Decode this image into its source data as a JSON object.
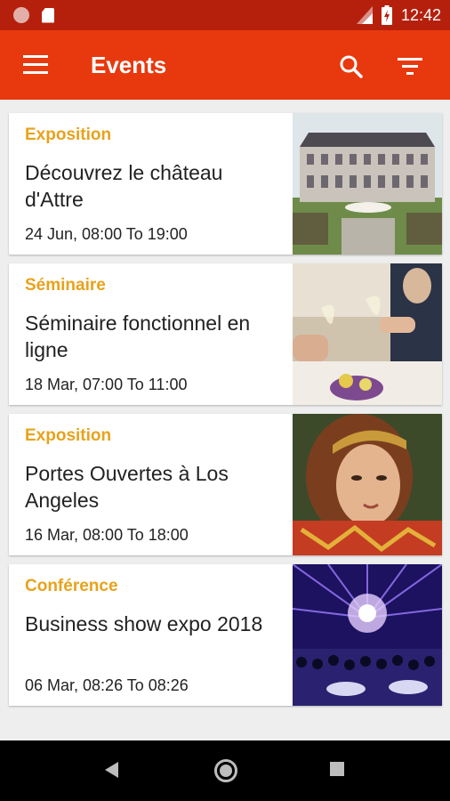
{
  "status": {
    "time": "12:42",
    "icons": [
      "notification-dot-icon",
      "sd-card-icon",
      "signal-icon",
      "battery-icon"
    ]
  },
  "appbar": {
    "title": "Events",
    "icons": [
      "menu-icon",
      "search-icon",
      "filter-icon"
    ]
  },
  "events": [
    {
      "category": "Exposition",
      "title": "Découvrez le château d'Attre",
      "time": "24 Jun, 08:00 To 19:00",
      "image": "chateau-photo"
    },
    {
      "category": "Séminaire",
      "title": "Séminaire fonctionnel en ligne",
      "time": "18 Mar, 07:00 To 11:00",
      "image": "toast-photo"
    },
    {
      "category": "Exposition",
      "title": "Portes Ouvertes à Los Angeles",
      "time": "16 Mar, 08:00 To 18:00",
      "image": "painting-photo"
    },
    {
      "category": "Conférence",
      "title": "Business show expo 2018",
      "time": "06 Mar, 08:26 To 08:26",
      "image": "concert-photo"
    }
  ],
  "colors": {
    "appbar": "#e8390e",
    "statusbar": "#b5200d",
    "category": "#e8a21b"
  }
}
